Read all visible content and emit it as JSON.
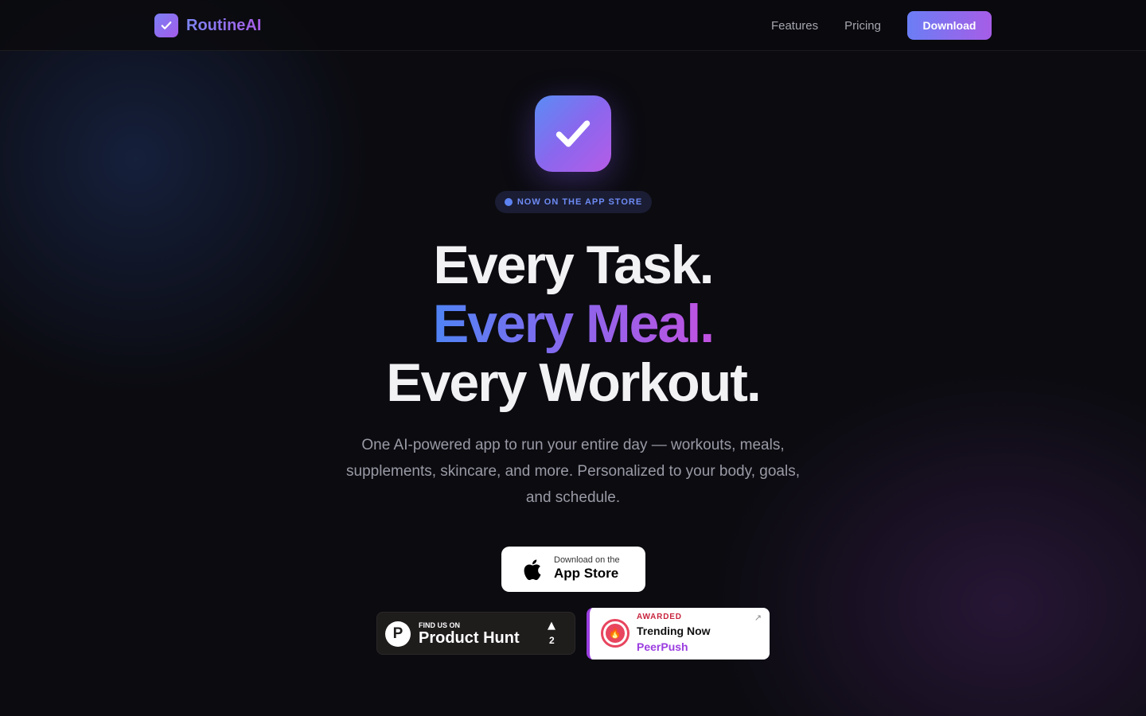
{
  "nav": {
    "brand": "RoutineAI",
    "links": [
      "Features",
      "Pricing"
    ],
    "download": "Download"
  },
  "hero": {
    "pill": "NOW ON THE APP STORE",
    "line1": "Every Task.",
    "line2": "Every Meal.",
    "line3": "Every Workout.",
    "subtitle": "One AI-powered app to run your entire day — workouts, meals, supplements, skincare, and more. Personalized to your body, goals, and schedule."
  },
  "appstore": {
    "small": "Download on the",
    "big": "App Store"
  },
  "producthunt": {
    "find": "FIND US ON",
    "name": "Product Hunt",
    "logo": "P",
    "count": "2"
  },
  "peerpush": {
    "awarded": "AWARDED",
    "title": "Trending Now",
    "brand": "PeerPush"
  },
  "icons": [
    "check-icon",
    "apple-icon",
    "upvote-arrow-icon",
    "fire-icon",
    "external-link-icon"
  ],
  "colors": {
    "background": "#0b0b10",
    "accent_blue": "#4f84f5",
    "accent_purple": "#a65de6",
    "pill_text": "#6e8bf5",
    "awarded_red": "#c8253e"
  }
}
